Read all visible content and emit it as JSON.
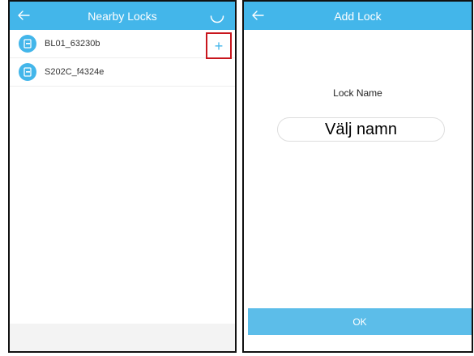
{
  "nearby": {
    "title": "Nearby Locks",
    "items": [
      {
        "label": "BL01_63230b",
        "icon": "lock-icon"
      },
      {
        "label": "S202C_f4324e",
        "icon": "lock-icon"
      }
    ],
    "add_symbol": "+"
  },
  "add_lock": {
    "title": "Add Lock",
    "field_label": "Lock Name",
    "input_value": "Välj namn",
    "ok_label": "OK"
  },
  "colors": {
    "header": "#43b6ea",
    "highlight_box": "#c8161d",
    "ok_button": "#5cbde9"
  }
}
